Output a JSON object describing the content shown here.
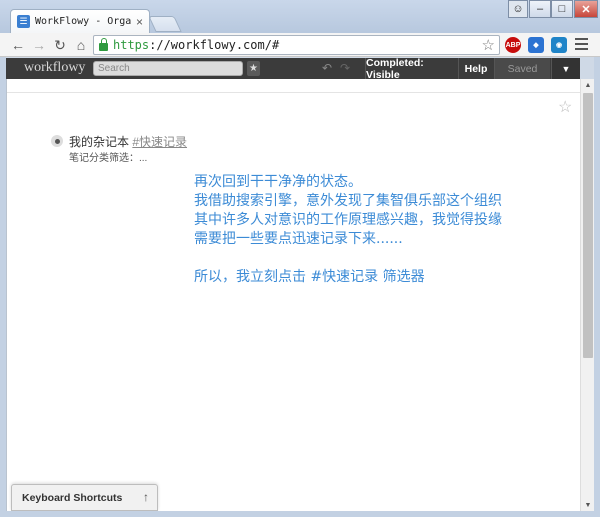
{
  "browser": {
    "tab_title": "WorkFlowy - Organize yo",
    "tab_close": "×",
    "url_scheme": "https",
    "url_rest": "://workflowy.com/#",
    "window_controls": {
      "minimize": "–",
      "maximize": "□",
      "close": "✕"
    },
    "extensions": {
      "abp_label": "ABP"
    }
  },
  "workflowy": {
    "logo": "workflowy",
    "search_placeholder": "Search",
    "completed_label": "Completed: Visible",
    "help_label": "Help",
    "saved_label": "Saved"
  },
  "page": {
    "item": {
      "title": "我的杂记本 ",
      "tag": "#快速记录",
      "note": "笔记分类筛选：..."
    },
    "annotation_lines": [
      "再次回到干干净净的状态。",
      "我借助搜索引擎，意外发现了集智俱乐部这个组织",
      "其中许多人对意识的工作原理感兴趣，我觉得投缘",
      "需要把一些要点迅速记录下来......",
      "",
      "所以，我立刻点击 #快速记录 筛选器"
    ]
  },
  "footer": {
    "keyboard_shortcuts_label": "Keyboard Shortcuts",
    "keyboard_shortcuts_arrow": "↑"
  },
  "colors": {
    "annotation": "#3c8bd6",
    "wf_bar": "#3b3b3b",
    "url_secure": "#2f9a3f"
  }
}
